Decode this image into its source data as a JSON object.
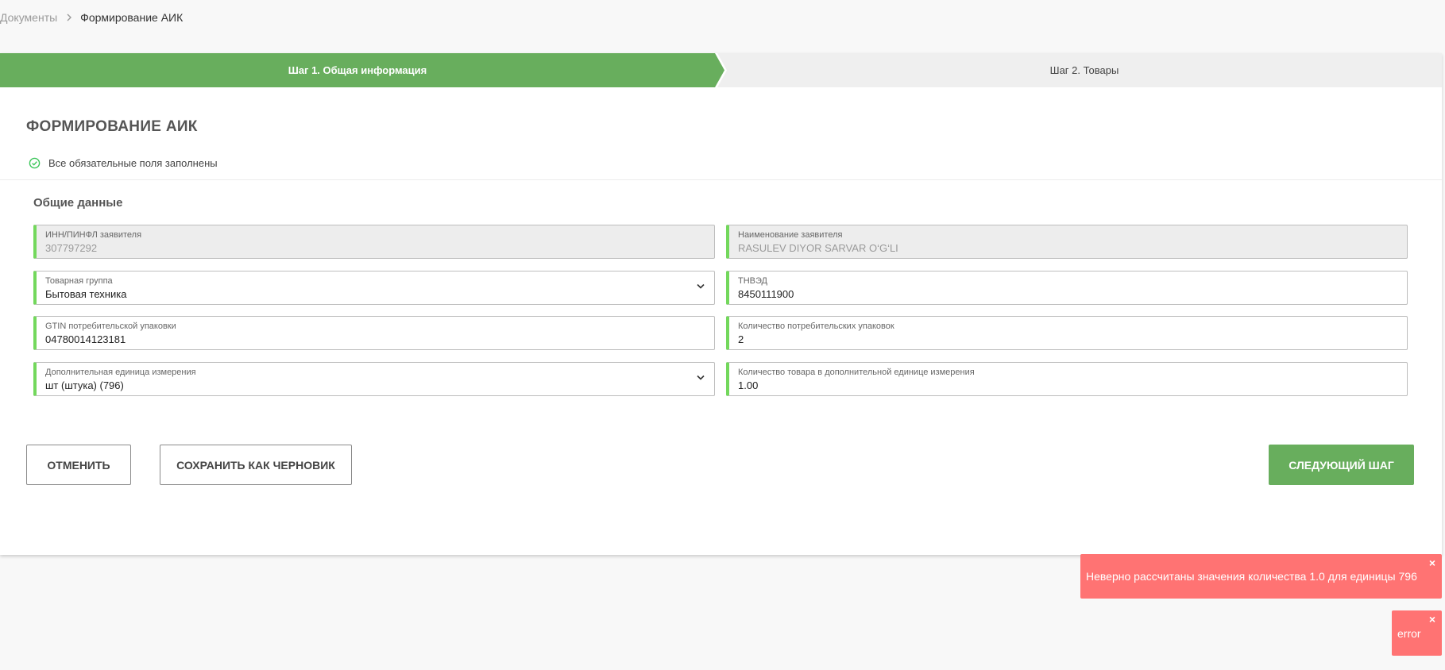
{
  "breadcrumb": {
    "parent": "Документы",
    "current": "Формирование АИК"
  },
  "stepper": {
    "step1": "Шаг 1. Общая информация",
    "step2": "Шаг 2. Товары"
  },
  "page_title": "ФОРМИРОВАНИЕ АИК",
  "status": {
    "text": "Все обязательные поля заполнены",
    "icon": "check-circle-icon"
  },
  "section_title": "Общие данные",
  "fields": {
    "inn": {
      "label": "ИНН/ПИНФЛ заявителя",
      "value": "307797292"
    },
    "applicant_name": {
      "label": "Наименование заявителя",
      "value": "RASULEV DIYOR SARVAR O‘G‘LI"
    },
    "product_group": {
      "label": "Товарная группа",
      "value": "Бытовая техника"
    },
    "tnved": {
      "label": "ТНВЭД",
      "value": "8450111900"
    },
    "gtin": {
      "label": "GTIN потребительской упаковки",
      "value": "04780014123181"
    },
    "package_count": {
      "label": "Количество потребительских упаковок",
      "value": "2"
    },
    "extra_unit": {
      "label": "Дополнительная единица измерения",
      "value": "шт (штука) (796)"
    },
    "extra_unit_qty": {
      "label": "Количество товара в дополнительной единице измерения",
      "value": "1.00"
    }
  },
  "buttons": {
    "cancel": "ОТМЕНИТЬ",
    "save_draft": "СОХРАНИТЬ КАК ЧЕРНОВИК",
    "next": "СЛЕДУЮЩИЙ ШАГ"
  },
  "toasts": {
    "error_message": "Неверно рассчитаны значения количества 1.0 для единицы 796",
    "error_short": "error",
    "close": "×"
  },
  "colors": {
    "accent_green": "#68ae5d",
    "field_marker": "#73d85c",
    "toast_error": "#ff7373"
  }
}
